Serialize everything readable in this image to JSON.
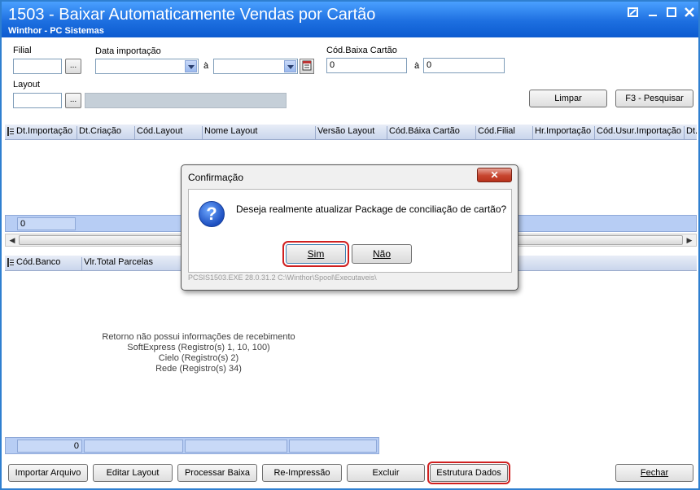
{
  "window": {
    "title": "1503 - Baixar Automaticamente Vendas por Cartão",
    "subtitle": "Winthor - PC Sistemas"
  },
  "filters": {
    "filial_label": "Filial",
    "filial_value": "",
    "data_importacao_label": "Data importação",
    "data_de_value": "",
    "a_label": "à",
    "data_ate_value": "",
    "cod_baixa_label": "Cód.Baixa Cartão",
    "cod_baixa_de": "0",
    "a2_label": "à",
    "cod_baixa_ate": "0",
    "layout_label": "Layout",
    "layout_value": "",
    "layout_desc": "",
    "dots_label": "...",
    "limpar_label": "Limpar",
    "pesquisar_label": "F3 - Pesquisar"
  },
  "grid1": {
    "columns": [
      "Dt.Importação",
      "Dt.Criação",
      "Cód.Layout",
      "Nome Layout",
      "Versão Layout",
      "Cód.Báixa Cartão",
      "Cód.Filial",
      "Hr.Importação",
      "Cód.Usur.Importação",
      "Dt."
    ],
    "summary_value": "0"
  },
  "grid2": {
    "columns": [
      "Cód.Banco",
      "Vlr.Total Parcelas"
    ],
    "info_lines": [
      "Retorno não possui informações de recebimento",
      "SoftExpress (Registro(s) 1, 10, 100)",
      "Cielo (Registro(s) 2)",
      "Rede (Registro(s) 34)"
    ],
    "summary_value": "0"
  },
  "bottom_buttons": {
    "importar": "Importar Arquivo",
    "editar": "Editar Layout",
    "processar": "Processar Baixa",
    "reimpressao": "Re-Impressão",
    "excluir": "Excluir",
    "estrutura": "Estrutura Dados",
    "fechar": "Fechar"
  },
  "dialog": {
    "title": "Confirmação",
    "close_glyph": "✕",
    "message": "Deseja realmente atualizar Package de conciliação de cartão?",
    "sim": "Sim",
    "nao": "Não",
    "footer": "PCSIS1503.EXE 28.0.31.2 C:\\Winthor\\Spool\\Executaveis\\"
  },
  "icons": {
    "question": "question-icon",
    "calendar": "calendar-icon",
    "grid": "grid-columns-icon"
  },
  "colors": {
    "titlebar": "#1d6fe0",
    "grid_header": "#c9d5ec",
    "summary_row": "#b7cdf4",
    "highlight": "#d02020"
  }
}
